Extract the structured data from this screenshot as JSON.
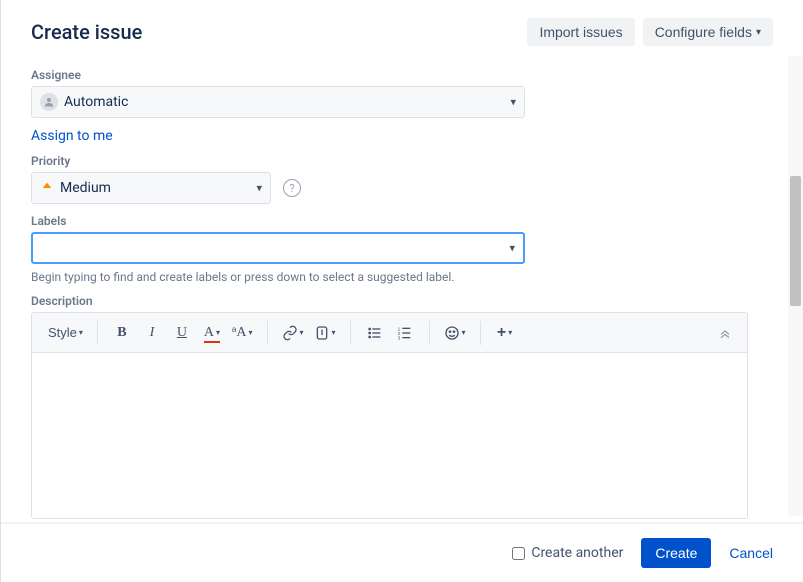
{
  "header": {
    "title": "Create issue",
    "import_label": "Import issues",
    "configure_label": "Configure fields"
  },
  "assignee": {
    "label": "Assignee",
    "value": "Automatic",
    "assign_to_me": "Assign to me"
  },
  "priority": {
    "label": "Priority",
    "value": "Medium",
    "icon_color": "#ff8b00"
  },
  "labels": {
    "label": "Labels",
    "value": "",
    "helper": "Begin typing to find and create labels or press down to select a suggested label."
  },
  "description": {
    "label": "Description",
    "toolbar": {
      "style": "Style",
      "bold": "B",
      "italic": "I",
      "underline": "U",
      "text_color": "A",
      "more_text": "A",
      "link": "link",
      "attach": "attach",
      "bullet": "ul",
      "number": "ol",
      "emoji": "emoji",
      "plus": "+"
    }
  },
  "footer": {
    "create_another": "Create another",
    "create": "Create",
    "cancel": "Cancel"
  }
}
